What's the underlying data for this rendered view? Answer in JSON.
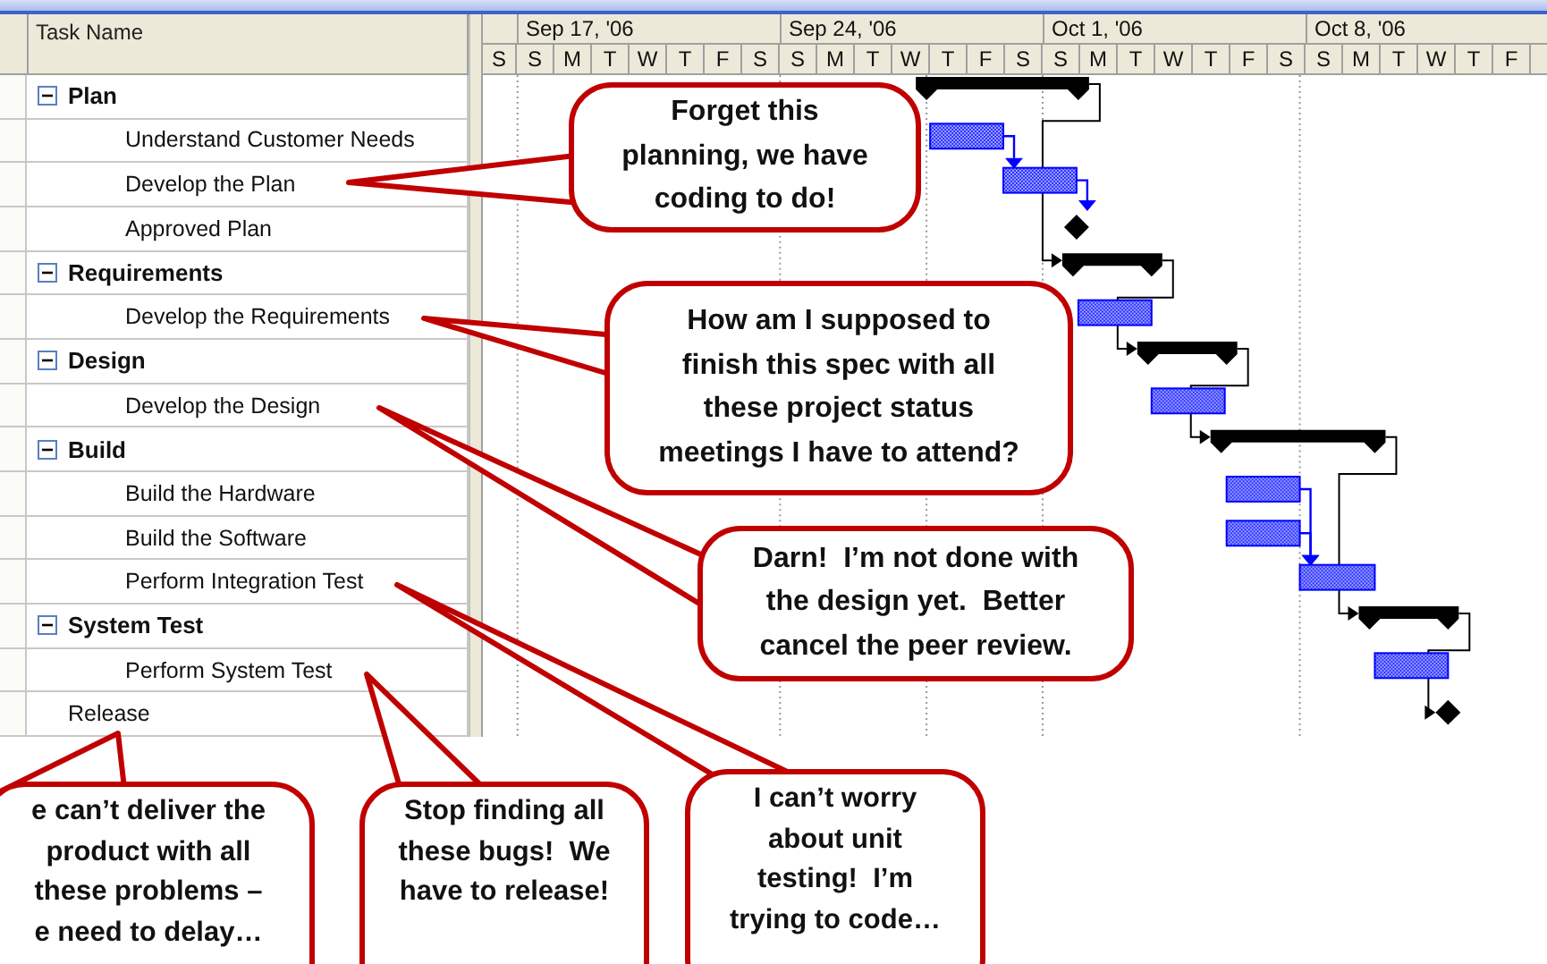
{
  "table": {
    "column": "Task Name",
    "rows": [
      {
        "name": "Plan",
        "kind": "summary",
        "expanded": true,
        "children": [
          {
            "name": "Understand Customer Needs",
            "kind": "task"
          },
          {
            "name": "Develop the Plan",
            "kind": "task"
          },
          {
            "name": "Approved Plan",
            "kind": "milestone"
          }
        ]
      },
      {
        "name": "Requirements",
        "kind": "summary",
        "expanded": true,
        "children": [
          {
            "name": "Develop the Requirements",
            "kind": "task"
          }
        ]
      },
      {
        "name": "Design",
        "kind": "summary",
        "expanded": true,
        "children": [
          {
            "name": "Develop the Design",
            "kind": "task"
          }
        ]
      },
      {
        "name": "Build",
        "kind": "summary",
        "expanded": true,
        "children": [
          {
            "name": "Build the Hardware",
            "kind": "task"
          },
          {
            "name": "Build the Software",
            "kind": "task"
          },
          {
            "name": "Perform Integration Test",
            "kind": "task"
          }
        ]
      },
      {
        "name": "System Test",
        "kind": "summary",
        "expanded": true,
        "children": [
          {
            "name": "Perform System Test",
            "kind": "task"
          }
        ]
      },
      {
        "name": "Release",
        "kind": "milestone"
      }
    ]
  },
  "timescale": {
    "weeks": [
      "Sep 17, '06",
      "Sep 24, '06",
      "Oct 1, '06",
      "Oct 8, '06"
    ],
    "days": [
      "S",
      "S",
      "M",
      "T",
      "W",
      "T",
      "F",
      "S",
      "S",
      "M",
      "T",
      "W",
      "T",
      "F",
      "S",
      "S",
      "M",
      "T",
      "W",
      "T",
      "F",
      "S",
      "S",
      "M",
      "T",
      "W",
      "T",
      "F"
    ]
  },
  "callouts": [
    {
      "lines": [
        "Forget this",
        "planning, we have",
        "coding to do!"
      ]
    },
    {
      "lines": [
        "How am I supposed to",
        "finish this spec with all",
        "these project status",
        "meetings I have to attend?"
      ]
    },
    {
      "lines": [
        "Darn!  I’m not done with",
        "the design yet.  Better",
        "cancel the peer review."
      ]
    },
    {
      "lines": [
        "e can’t deliver the",
        "product with all",
        "these problems –",
        "e need to delay…"
      ]
    },
    {
      "lines": [
        "Stop finding all",
        "these bugs!  We",
        "have to release!"
      ]
    },
    {
      "lines": [
        "I can’t worry",
        "about unit",
        "testing!  I’m",
        "trying to code…"
      ]
    }
  ]
}
